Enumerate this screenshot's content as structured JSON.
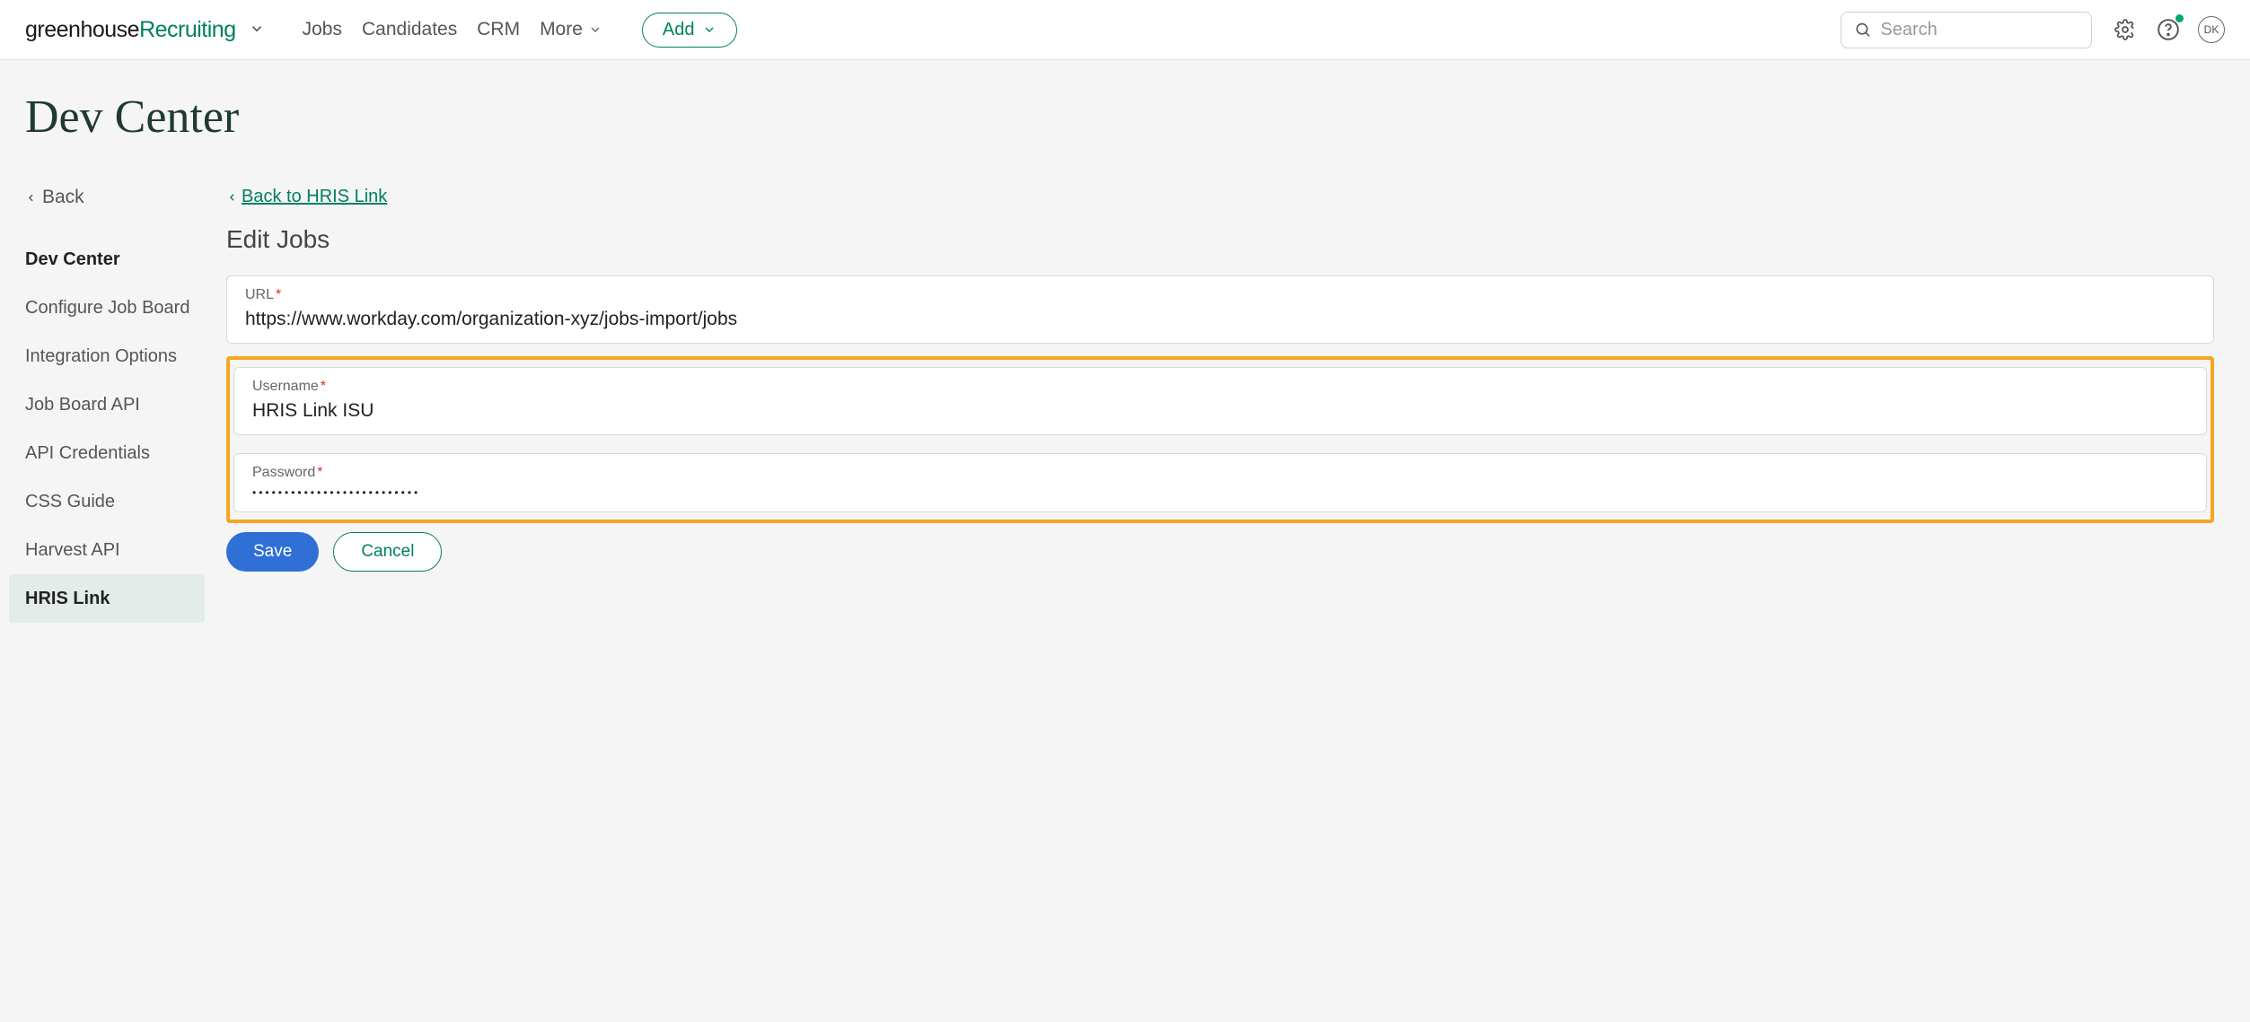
{
  "header": {
    "logo_part1": "greenhouse",
    "logo_part2": " Recruiting",
    "nav": {
      "jobs": "Jobs",
      "candidates": "Candidates",
      "crm": "CRM",
      "more": "More"
    },
    "add_label": "Add",
    "search_placeholder": "Search",
    "avatar_initials": "DK"
  },
  "page": {
    "title": "Dev Center"
  },
  "sidebar": {
    "back_label": "Back",
    "items": [
      "Dev Center",
      "Configure Job Board",
      "Integration Options",
      "Job Board API",
      "API Credentials",
      "CSS Guide",
      "Harvest API",
      "HRIS Link"
    ]
  },
  "main": {
    "breadcrumb_label": "Back to HRIS Link",
    "section_title": "Edit Jobs",
    "fields": {
      "url": {
        "label": "URL",
        "value": "https://www.workday.com/organization-xyz/jobs-import/jobs"
      },
      "username": {
        "label": "Username",
        "value": "HRIS Link ISU"
      },
      "password": {
        "label": "Password",
        "value": "••••••••••••••••••••••••••"
      }
    },
    "save_label": "Save",
    "cancel_label": "Cancel"
  }
}
